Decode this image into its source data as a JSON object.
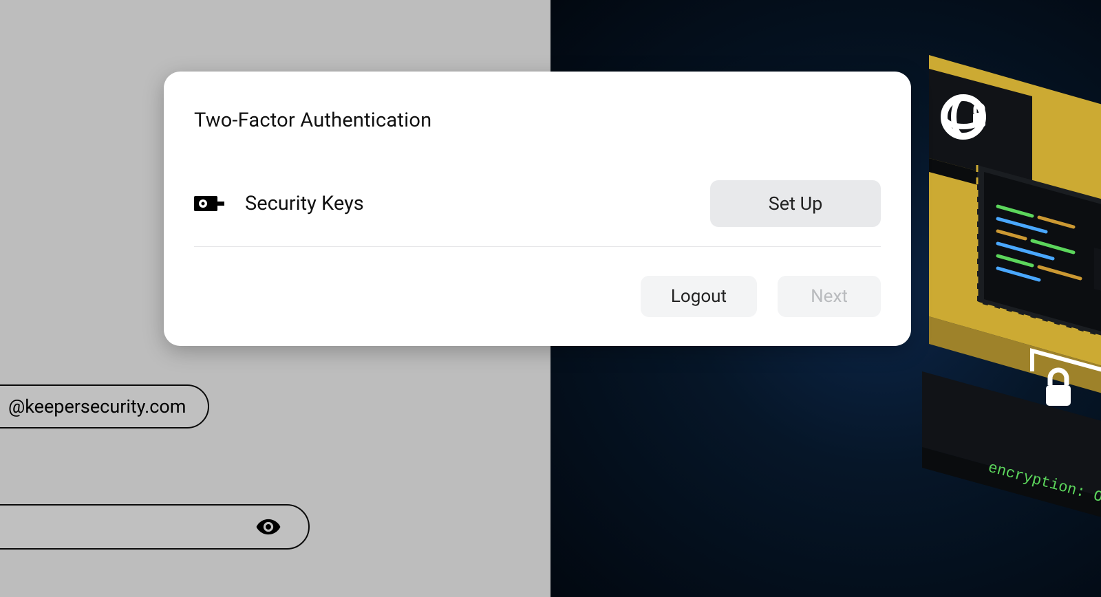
{
  "background": {
    "email_hint": "@keepersecurity.com",
    "encryption_label": "encryption: ON"
  },
  "modal": {
    "title": "Two-Factor Authentication",
    "method": {
      "label": "Security Keys",
      "setup_label": "Set Up"
    },
    "footer": {
      "logout_label": "Logout",
      "next_label": "Next"
    }
  },
  "colors": {
    "accent_yellow": "#ccaa33",
    "dark_navy": "#061628",
    "panel_black": "#111317",
    "code_green": "#5cd65c"
  }
}
